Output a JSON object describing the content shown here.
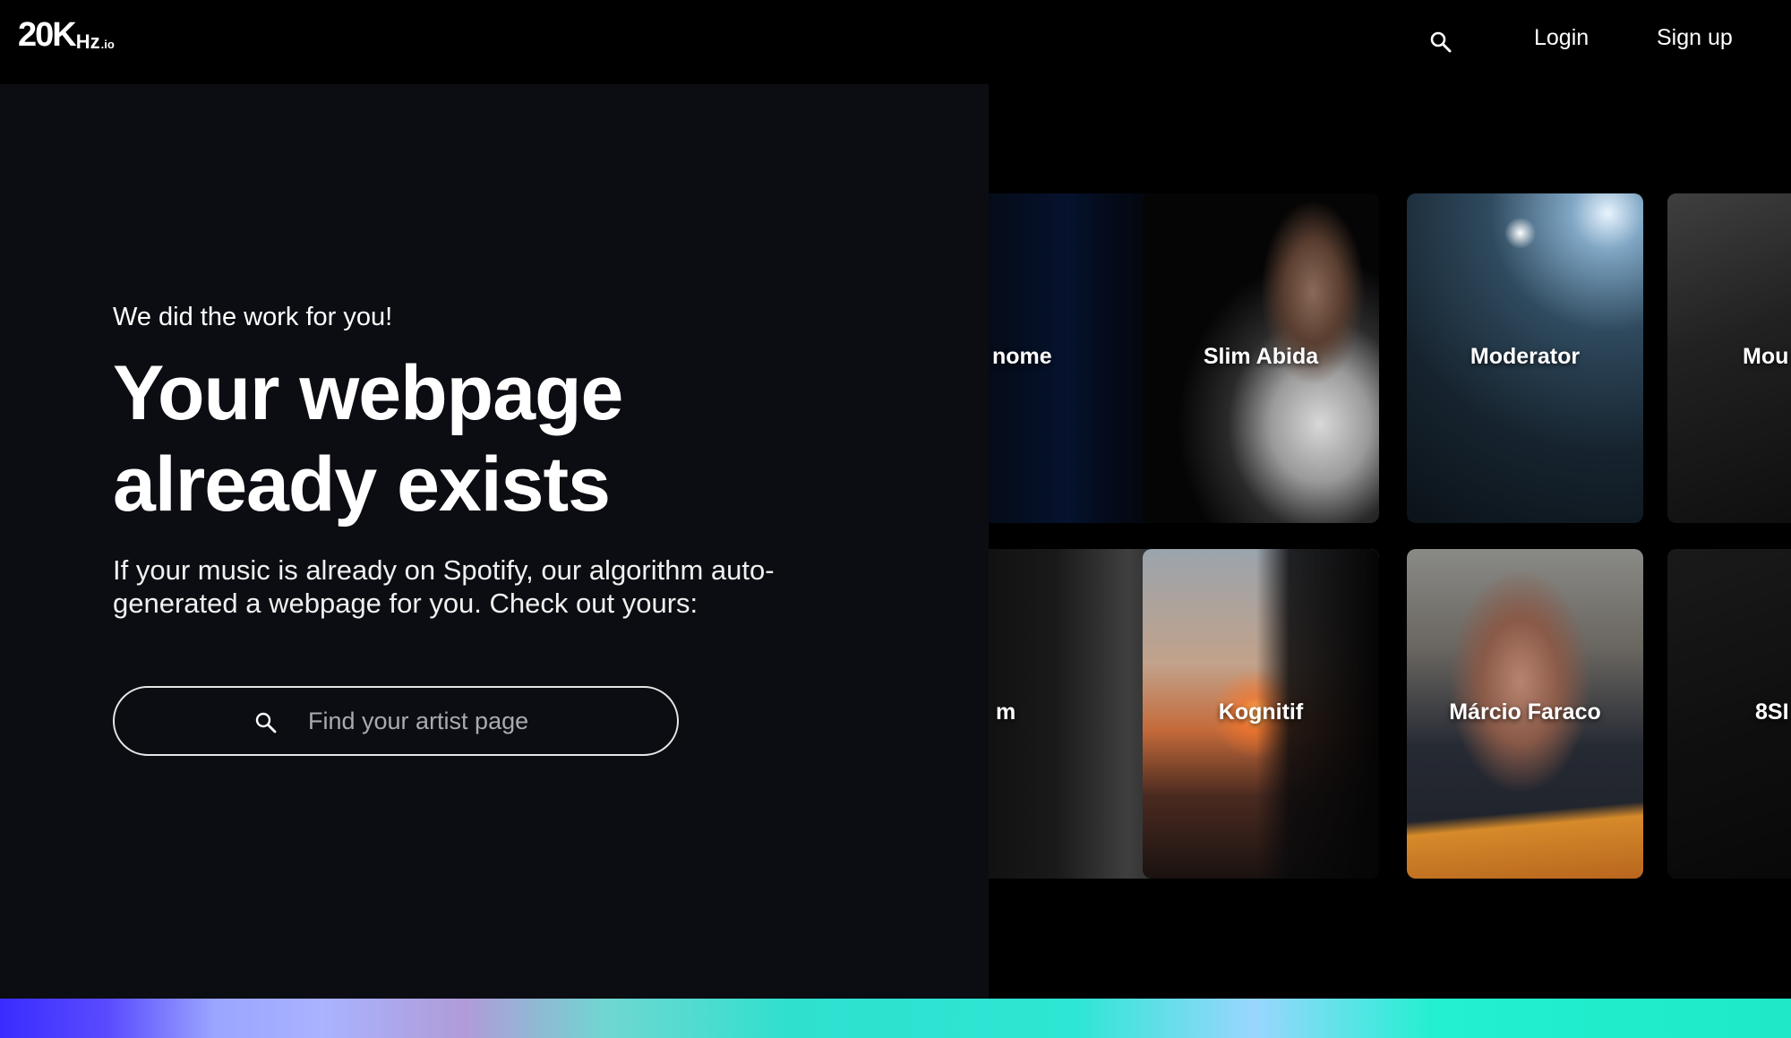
{
  "header": {
    "logo": {
      "big": "20K",
      "small": "Hz",
      "tiny": ".io"
    },
    "search_icon": "search-icon",
    "login_label": "Login",
    "signup_label": "Sign up"
  },
  "hero": {
    "eyebrow": "We did the work for you!",
    "title_line1": "Your webpage",
    "title_line2": "already exists",
    "description": "If your music is already on Spotify, our algorithm auto-generated a webpage for you. Check out yours:",
    "search_placeholder": "Find your artist page"
  },
  "gallery": {
    "cards": [
      {
        "name": "nome"
      },
      {
        "name": "Slim Abida"
      },
      {
        "name": "Moderator"
      },
      {
        "name": "Mou"
      },
      {
        "name": "m"
      },
      {
        "name": "Kognitif"
      },
      {
        "name": "Márcio Faraco"
      },
      {
        "name": "8SI"
      }
    ]
  },
  "colors": {
    "background": "#000000",
    "hero_bg": "#0b0d12",
    "accent_gradient_start": "#3a2cff",
    "accent_gradient_end": "#1ee8c8"
  }
}
